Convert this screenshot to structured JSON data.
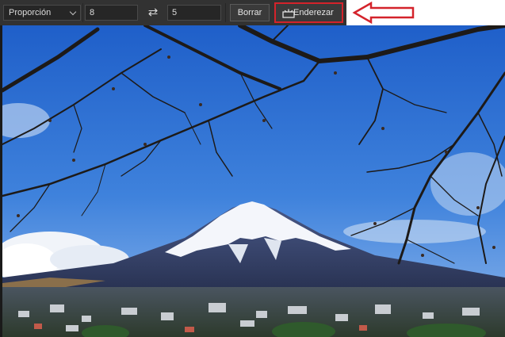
{
  "options_bar": {
    "ratio_dropdown": "Proporción",
    "width_value": "8",
    "height_value": "5",
    "clear_label": "Borrar",
    "straighten_label": "Enderezar"
  },
  "icons": {
    "swap": "swap-arrows-icon",
    "straighten": "level-icon",
    "chevron": "chevron-down-icon",
    "callout_arrow": "red-arrow-icon"
  },
  "colors": {
    "bar_bg": "#323232",
    "highlight": "#d4232b",
    "sky_top": "#1f5fc9",
    "sky_bottom": "#6fa3e6"
  }
}
